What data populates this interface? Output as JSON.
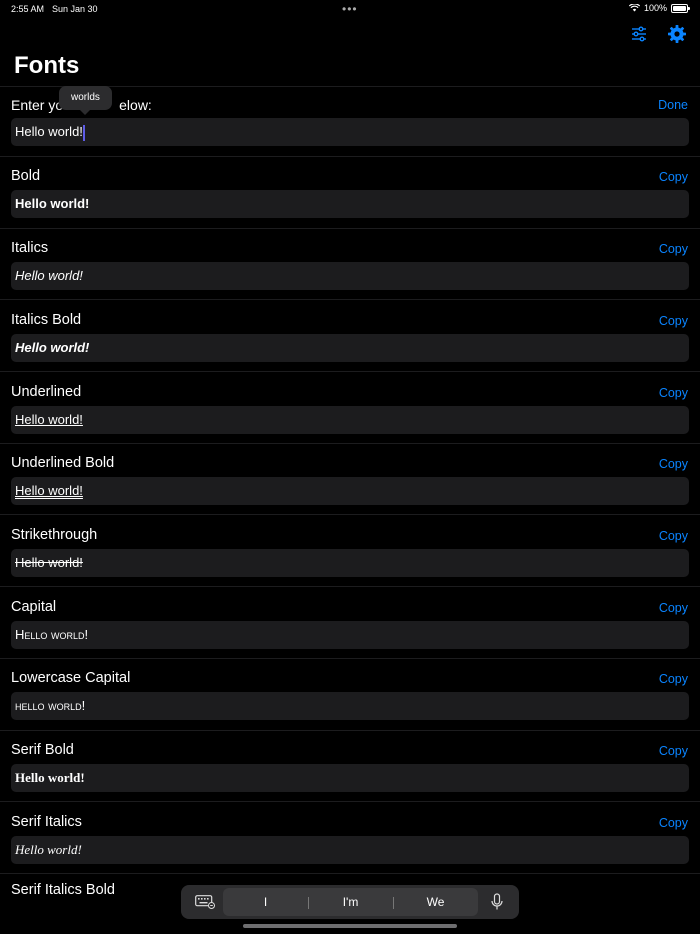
{
  "status": {
    "time": "2:55 AM",
    "date": "Sun Jan 30",
    "battery": "100%",
    "battery_fraction": 1.0
  },
  "title": "Fonts",
  "input": {
    "label": "Enter yo",
    "label_tail": "elow:",
    "done": "Done",
    "value": "Hello world!"
  },
  "autocorrect": {
    "suggestion": "worlds"
  },
  "copy_label": "Copy",
  "sections": [
    {
      "label": "Bold",
      "value": "Hello world!"
    },
    {
      "label": "Italics",
      "value": "Hello world!"
    },
    {
      "label": "Italics Bold",
      "value": "Hello world!"
    },
    {
      "label": "Underlined",
      "value": "Hello world!"
    },
    {
      "label": "Underlined Bold",
      "value": "Hello world!"
    },
    {
      "label": "Strikethrough",
      "value": "Hello world!"
    },
    {
      "label": "Capital",
      "value": "Hello world!"
    },
    {
      "label": "Lowercase Capital",
      "value": "hello world!"
    },
    {
      "label": "Serif Bold",
      "value": "Hello world!"
    },
    {
      "label": "Serif Italics",
      "value": "Hello world!"
    }
  ],
  "cutoff_label": "Serif Italics Bold",
  "keyboard": {
    "suggestions": [
      "I",
      "I'm",
      "We"
    ]
  },
  "icons": {
    "toolbar_left": "sliders-icon",
    "toolbar_right": "gear-icon",
    "accent": "#0a84ff"
  }
}
